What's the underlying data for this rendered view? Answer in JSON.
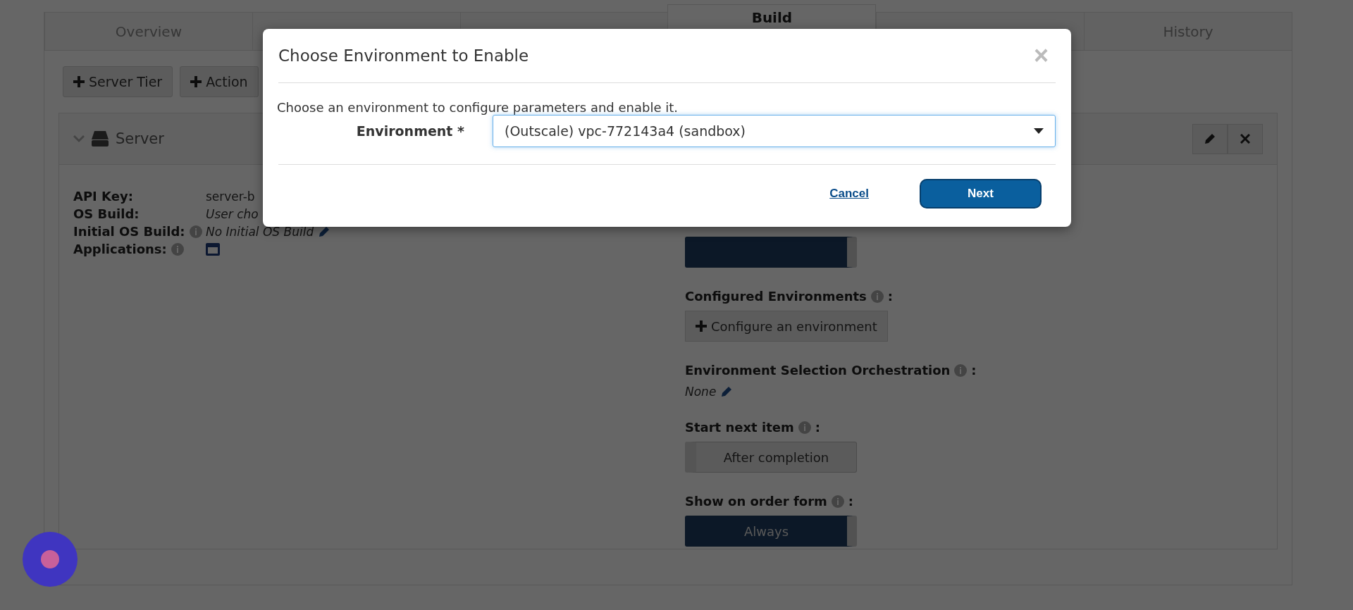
{
  "tabs": [
    {
      "label": "Overview",
      "selected": false
    },
    {
      "selected": false
    },
    {
      "selected": false
    },
    {
      "label": "Build",
      "selected": true
    },
    {
      "selected": false
    },
    {
      "label": "History",
      "selected": false
    }
  ],
  "toolbar": [
    {
      "label": "Server Tier"
    },
    {
      "label": "Action"
    }
  ],
  "server_panel": {
    "title": "Server",
    "properties": [
      {
        "label": "API Key:",
        "value": "server-b",
        "info": false,
        "kind": "text"
      },
      {
        "label": "OS Build:",
        "value": "User cho",
        "info": false,
        "kind": "italic"
      },
      {
        "label": "Initial OS Build:",
        "value": "No Initial OS Build",
        "info": true,
        "kind": "editable"
      },
      {
        "label": "Applications:",
        "info": true,
        "kind": "icon"
      }
    ],
    "settings": [
      {
        "kind": "toggle",
        "on": true
      },
      {
        "kind": "button",
        "label": "Configured Environments",
        "info": true,
        "suffix": ":",
        "button": "Configure an environment"
      },
      {
        "kind": "editable",
        "label": "Environment Selection Orchestration",
        "info": true,
        "suffix": ":",
        "value": "None"
      },
      {
        "kind": "toggle",
        "label": "Start next item",
        "info": true,
        "suffix": ":",
        "value": "After completion",
        "on": false
      },
      {
        "kind": "toggle",
        "label": "Show on order form",
        "info": true,
        "suffix": ":",
        "value": "Always",
        "on": true
      }
    ]
  },
  "dialog": {
    "title": "Choose Environment to Enable",
    "close": "×",
    "message": "Choose an environment to configure parameters and enable it.",
    "field_label": "Environment *",
    "field_value": "(Outscale) vpc-772143a4 (sandbox)",
    "cancel": "Cancel",
    "next": "Next"
  }
}
